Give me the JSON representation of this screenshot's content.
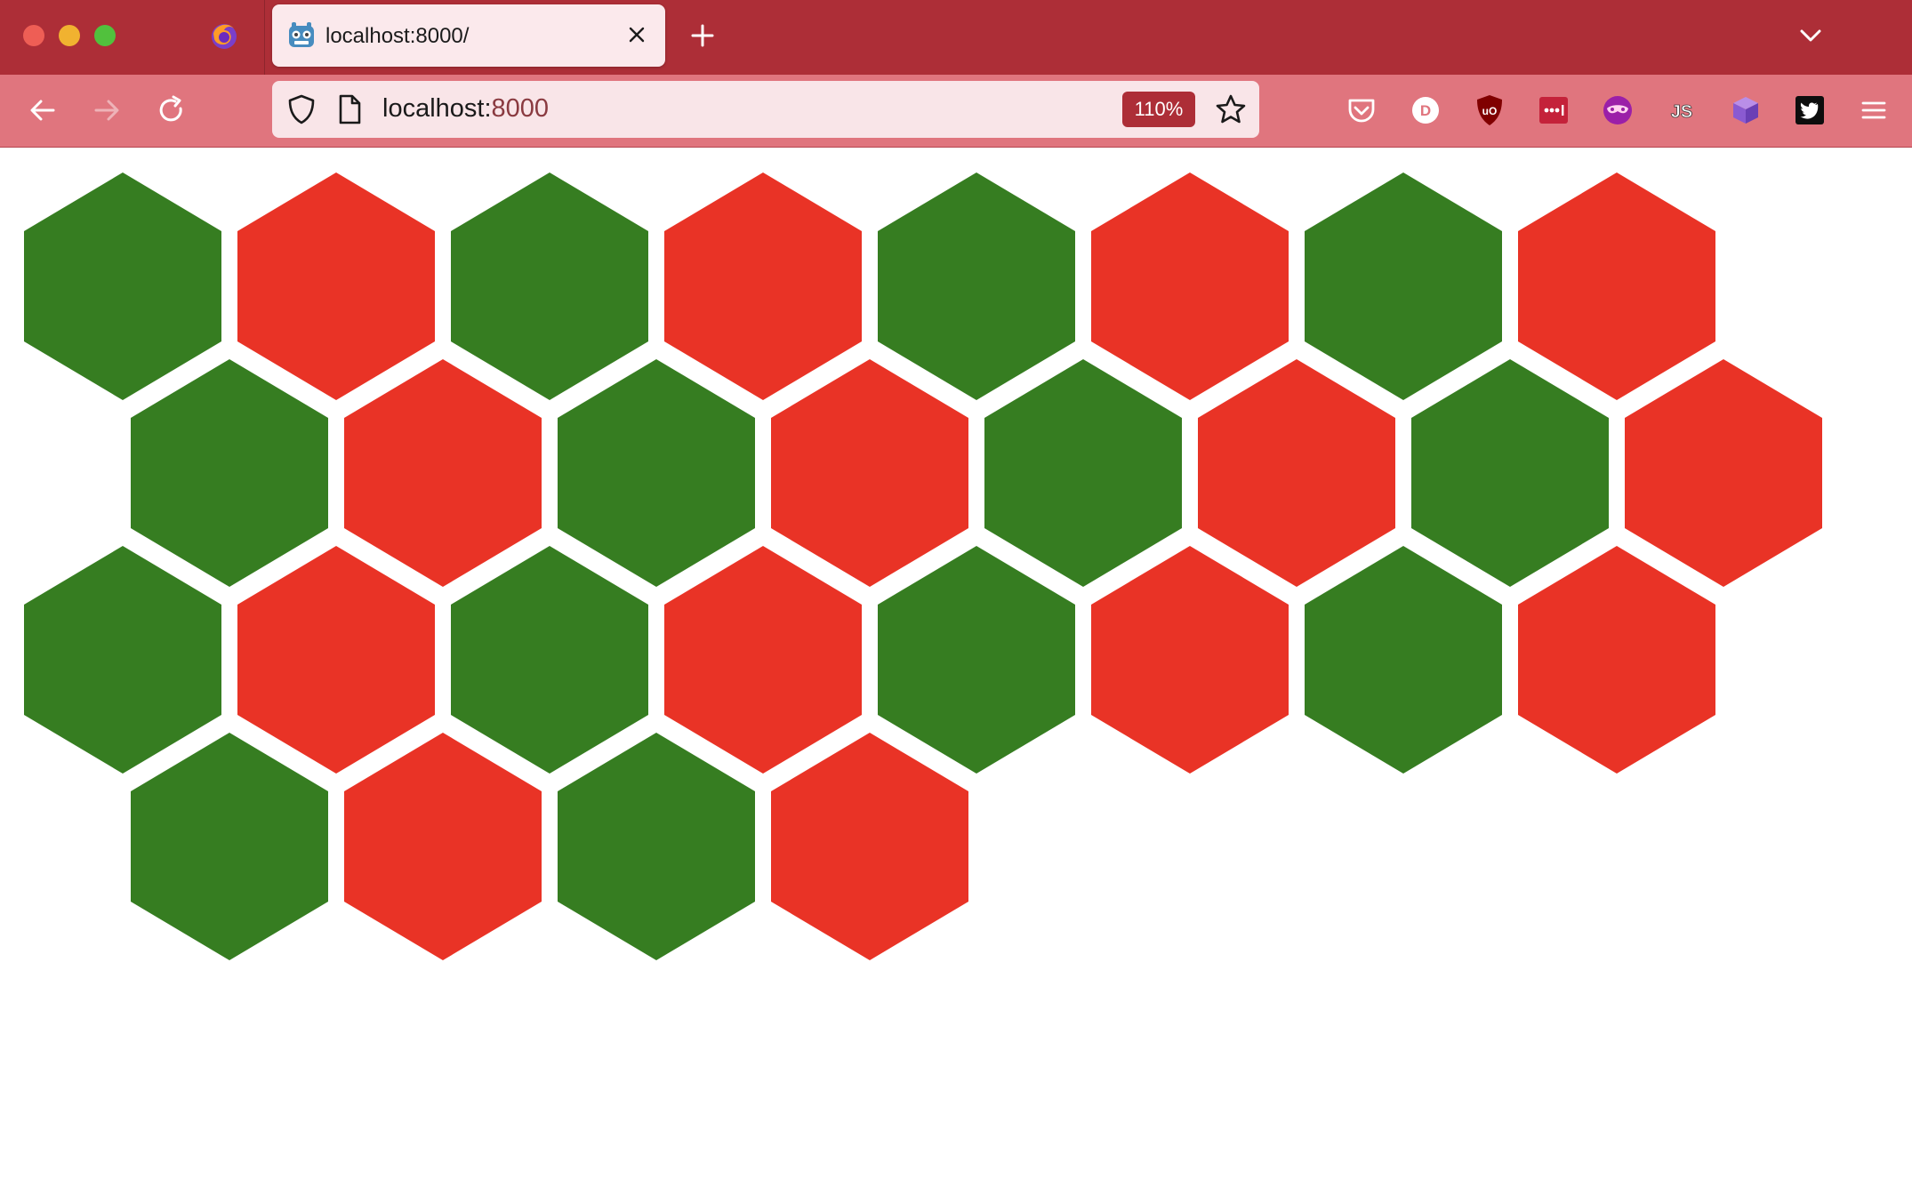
{
  "browser": {
    "tab": {
      "title": "localhost:8000/"
    },
    "url": {
      "host": "localhost:",
      "port": "8000"
    },
    "zoom": "110%",
    "toolbar_icons": [
      "pocket-icon",
      "d-extension-icon",
      "ublock-origin-icon",
      "lastpass-icon",
      "incognito-mask-icon",
      "js-toggle-icon",
      "purple-cube-icon",
      "twitter-icon",
      "hamburger-menu-icon"
    ]
  },
  "colors": {
    "tabbar": "#ad2e37",
    "navbar": "#e0757e",
    "hex_green": "#367d21",
    "hex_red": "#e93326"
  },
  "hex_grid": {
    "rows": [
      [
        "green",
        "red",
        "green",
        "red",
        "green",
        "red",
        "green",
        "red"
      ],
      [
        "green",
        "red",
        "green",
        "red",
        "green",
        "red",
        "green",
        "red"
      ],
      [
        "green",
        "red",
        "green",
        "red",
        "green",
        "red",
        "green",
        "red"
      ],
      [
        "green",
        "red",
        "green",
        "red"
      ]
    ]
  }
}
